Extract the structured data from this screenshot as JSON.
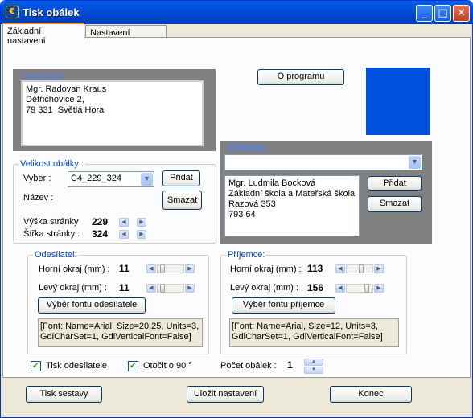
{
  "window": {
    "title": "Tisk obálek",
    "minimize": "_",
    "maximize": "□",
    "close": "✕",
    "icon_letter": "€"
  },
  "tabs": [
    {
      "label": "Základní nastavení"
    },
    {
      "label": "Nastavení obrázku"
    }
  ],
  "sender": {
    "label": "Odesílatel :",
    "text": "Mgr. Radovan Kraus\nDětřichovice 2,\n79 331  Světlá Hora"
  },
  "about_button": "O programu",
  "preview_color": "#0050e0",
  "recipient": {
    "label": "Příjemce :",
    "combo_value": "",
    "text": "Mgr. Ludmila Bocková\nZákladní škola a Mateřská škola\nRazová 353\n793 64",
    "add": "Přidat",
    "delete": "Smazat"
  },
  "envelope_size": {
    "label": "Velikost obálky :",
    "select_label": "Vyber :",
    "select_value": "C4_229_324",
    "add": "Přidat",
    "name_label": "Název :",
    "delete": "Smazat",
    "height_label": "Výška stránky",
    "height_value": "229",
    "width_label": "Šířka stránky :",
    "width_value": "324"
  },
  "sender_font": {
    "label": "Odesílatel:",
    "top_label": "Horní okraj (mm) :",
    "top_value": "11",
    "left_label": "Levý  okraj (mm) :",
    "left_value": "11",
    "font_button": "Výběr fontu odesílatele",
    "font_info": "[Font: Name=Arial, Size=20,25, Units=3,\nGdiCharSet=1, GdiVerticalFont=False]"
  },
  "recipient_font": {
    "label": "Příjemce:",
    "top_label": "Horní okraj (mm) :",
    "top_value": "113",
    "left_label": "Levý  okraj (mm) :",
    "left_value": "156",
    "font_button": "Výběr fontu příjemce",
    "font_info": "[Font: Name=Arial, Size=12, Units=3,\nGdiCharSet=1, GdiVerticalFont=False]"
  },
  "options": {
    "print_sender": "Tisk odesílatele",
    "print_sender_checked": true,
    "rotate": "Otočit o 90 °",
    "rotate_checked": true,
    "count_label": "Počet obálek :",
    "count_value": "1"
  },
  "footer": {
    "print": "Tisk sestavy",
    "save": "Uložit nastavení",
    "exit": "Konec"
  },
  "checkmark": "✓"
}
